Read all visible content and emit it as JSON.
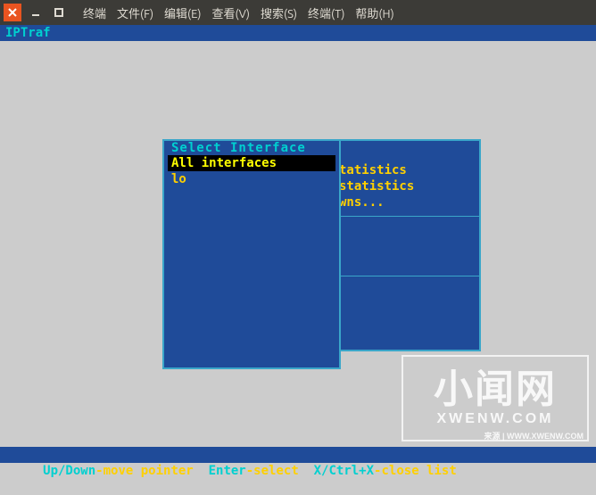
{
  "window": {
    "menus": [
      "终端",
      "文件(F)",
      "编辑(E)",
      "查看(V)",
      "搜索(S)",
      "终端(T)",
      "帮助(H)"
    ]
  },
  "app": {
    "title": "IPTraf"
  },
  "bg_menu": {
    "lines": [
      "tatistics",
      "statistics",
      "wns..."
    ]
  },
  "interface_box": {
    "title": "Select Interface",
    "items": [
      {
        "label": "All interfaces",
        "selected": true
      },
      {
        "label": "lo",
        "selected": false
      }
    ]
  },
  "status": {
    "k1": " Up/Down",
    "t1": "-move pointer  ",
    "k2": "Enter",
    "t2": "-select  ",
    "k3": "X/Ctrl+X",
    "t3": "-close list"
  },
  "watermark": {
    "big": "小闻网",
    "sub": "XWENW.COM",
    "url": "来源 | WWW.XWENW.COM"
  }
}
